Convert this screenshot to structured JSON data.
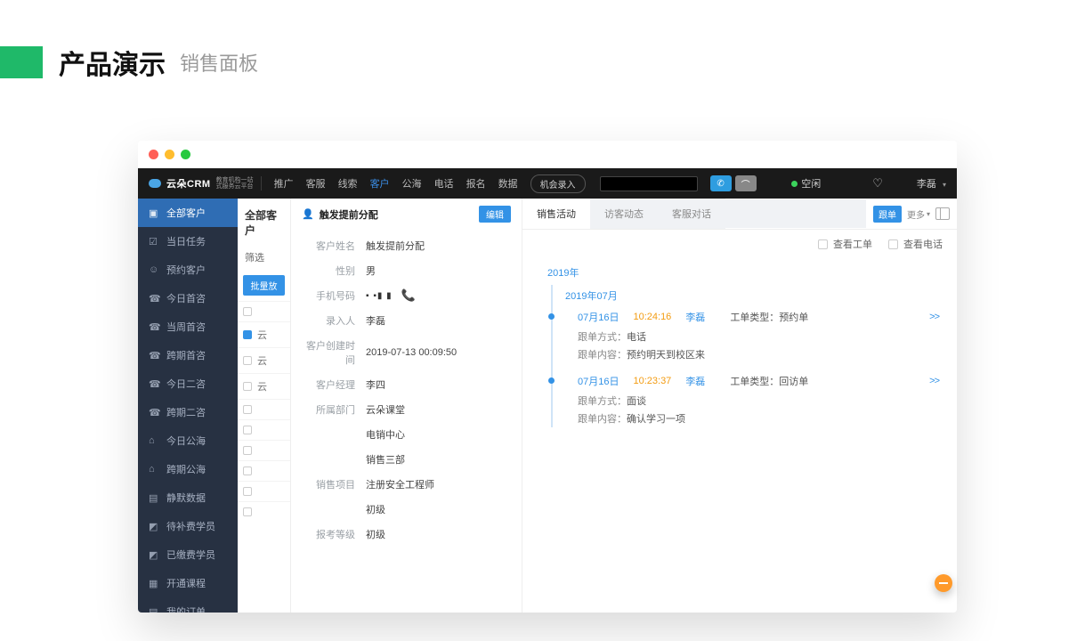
{
  "page": {
    "title": "产品演示",
    "subtitle": "销售面板"
  },
  "topbar": {
    "logo_text": "云朵CRM",
    "logo_sub1": "教育机构一站",
    "logo_sub2": "式服务云平台",
    "nav": [
      "推广",
      "客服",
      "线索",
      "客户",
      "公海",
      "电话",
      "报名",
      "数据"
    ],
    "nav_active_index": 3,
    "pill": "机会录入",
    "status": "空闲",
    "username": "李磊"
  },
  "sidebar": {
    "items": [
      {
        "icon": "▣",
        "label": "全部客户",
        "active": true
      },
      {
        "icon": "☑",
        "label": "当日任务"
      },
      {
        "icon": "☺",
        "label": "预约客户"
      },
      {
        "icon": "☎",
        "label": "今日首咨"
      },
      {
        "icon": "☎",
        "label": "当周首咨"
      },
      {
        "icon": "☎",
        "label": "跨期首咨"
      },
      {
        "icon": "☎",
        "label": "今日二咨"
      },
      {
        "icon": "☎",
        "label": "跨期二咨"
      },
      {
        "icon": "⌂",
        "label": "今日公海"
      },
      {
        "icon": "⌂",
        "label": "跨期公海"
      },
      {
        "icon": "▤",
        "label": "静默数据"
      },
      {
        "icon": "◩",
        "label": "待补费学员"
      },
      {
        "icon": "◩",
        "label": "已缴费学员"
      },
      {
        "icon": "▦",
        "label": "开通课程"
      },
      {
        "icon": "▤",
        "label": "我的订单"
      }
    ]
  },
  "list": {
    "header": "全部客户",
    "filter_label": "筛选",
    "batch_label": "批量放",
    "rows": [
      {
        "text": "",
        "checked": false
      },
      {
        "text": "云",
        "checked": true
      },
      {
        "text": "云",
        "checked": false
      },
      {
        "text": "云",
        "checked": false
      },
      {
        "text": "",
        "checked": false
      },
      {
        "text": "",
        "checked": false
      },
      {
        "text": "",
        "checked": false
      },
      {
        "text": "",
        "checked": false
      },
      {
        "text": "",
        "checked": false
      },
      {
        "text": "",
        "checked": false
      }
    ]
  },
  "detail": {
    "title": "触发提前分配",
    "edit_label": "编辑",
    "fields": [
      {
        "label": "客户姓名",
        "value": "触发提前分配"
      },
      {
        "label": "性别",
        "value": "男"
      },
      {
        "label": "手机号码",
        "value": "▪ ▪▮ ▮",
        "is_phone": true
      },
      {
        "label": "录入人",
        "value": "李磊"
      },
      {
        "label": "客户创建时间",
        "value": "2019-07-13 00:09:50"
      },
      {
        "label": "客户经理",
        "value": "李四"
      },
      {
        "label": "所属部门",
        "value": "云朵课堂"
      },
      {
        "label": "",
        "value": "电销中心"
      },
      {
        "label": "",
        "value": "销售三部"
      },
      {
        "label": "销售项目",
        "value": "注册安全工程师"
      },
      {
        "label": "",
        "value": "初级"
      },
      {
        "label": "报考等级",
        "value": "初级"
      }
    ]
  },
  "activity": {
    "tabs": [
      "销售活动",
      "访客动态",
      "客服对话"
    ],
    "active_tab": 0,
    "mini_btn": "跟单",
    "more": "更多",
    "filters": [
      {
        "label": "查看工单"
      },
      {
        "label": "查看电话"
      }
    ],
    "year": "2019年",
    "month": "2019年07月",
    "events": [
      {
        "date": "07月16日",
        "time": "10:24:16",
        "user": "李磊",
        "type_label": "工单类型：",
        "type_value": "预约单",
        "rows": [
          {
            "label": "跟单方式：",
            "value": "电话"
          },
          {
            "label": "跟单内容：",
            "value": "预约明天到校区来"
          }
        ]
      },
      {
        "date": "07月16日",
        "time": "10:23:37",
        "user": "李磊",
        "type_label": "工单类型：",
        "type_value": "回访单",
        "rows": [
          {
            "label": "跟单方式：",
            "value": "面谈"
          },
          {
            "label": "跟单内容：",
            "value": "确认学习一项"
          }
        ]
      }
    ]
  }
}
